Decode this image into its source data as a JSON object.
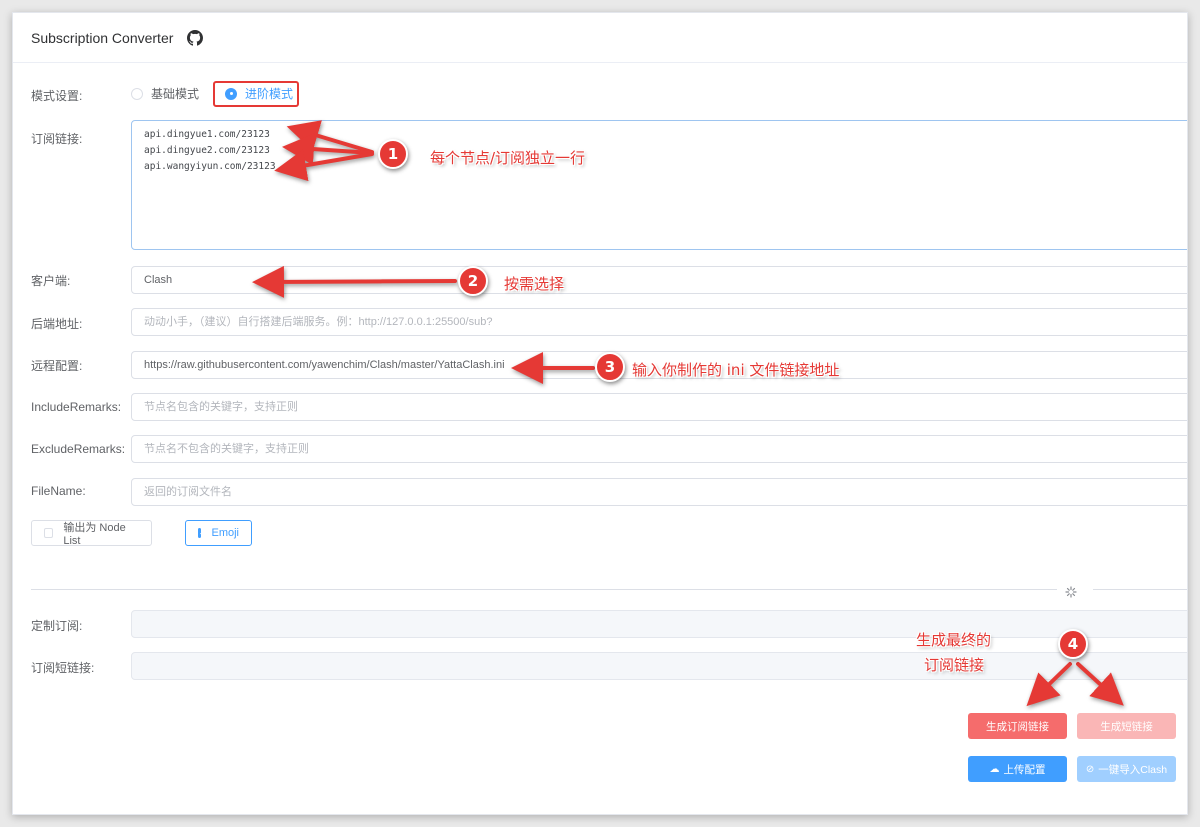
{
  "header": {
    "title": "Subscription Converter",
    "github_icon": "github-icon"
  },
  "mode": {
    "label": "模式设置:",
    "options": [
      "基础模式",
      "进阶模式"
    ],
    "selected": "进阶模式"
  },
  "subscription": {
    "label": "订阅链接:",
    "lines": [
      "api.dingyue1.com/23123",
      "api.dingyue2.com/23123",
      "api.wangyiyun.com/23123"
    ]
  },
  "client": {
    "label": "客户端:",
    "value": "Clash"
  },
  "backend": {
    "label": "后端地址:",
    "placeholder": "动动小手，（建议）自行搭建后端服务。例：http://127.0.0.1:25500/sub?"
  },
  "remote_config": {
    "label": "远程配置:",
    "value": "https://raw.githubusercontent.com/yawenchim/Clash/master/YattaClash.ini"
  },
  "include_remarks": {
    "label": "IncludeRemarks:",
    "placeholder": "节点名包含的关键字，支持正则"
  },
  "exclude_remarks": {
    "label": "ExcludeRemarks:",
    "placeholder": "节点名不包含的关键字，支持正则"
  },
  "filename": {
    "label": "FileName:",
    "placeholder": "返回的订阅文件名"
  },
  "options": {
    "node_list_label": "输出为 Node List",
    "node_list_checked": false,
    "emoji_label": "Emoji",
    "emoji_checked": true
  },
  "custom_sub": {
    "label": "定制订阅:",
    "value": ""
  },
  "short_link": {
    "label": "订阅短链接:",
    "value": ""
  },
  "buttons": {
    "generate_sub": "生成订阅链接",
    "generate_short": "生成短链接",
    "upload_config": "上传配置",
    "import_clash": "一键导入Clash"
  },
  "annotations": {
    "a1": {
      "num": "1",
      "text": "每个节点/订阅独立一行"
    },
    "a2": {
      "num": "2",
      "text": "按需选择"
    },
    "a3": {
      "num": "3",
      "text": "输入你制作的 ini 文件链接地址"
    },
    "a4": {
      "num": "4",
      "text_line1": "生成最终的",
      "text_line2": "订阅链接"
    }
  },
  "colors": {
    "accent": "#409eff",
    "danger": "#f56c6c",
    "annotation": "#e53935"
  }
}
